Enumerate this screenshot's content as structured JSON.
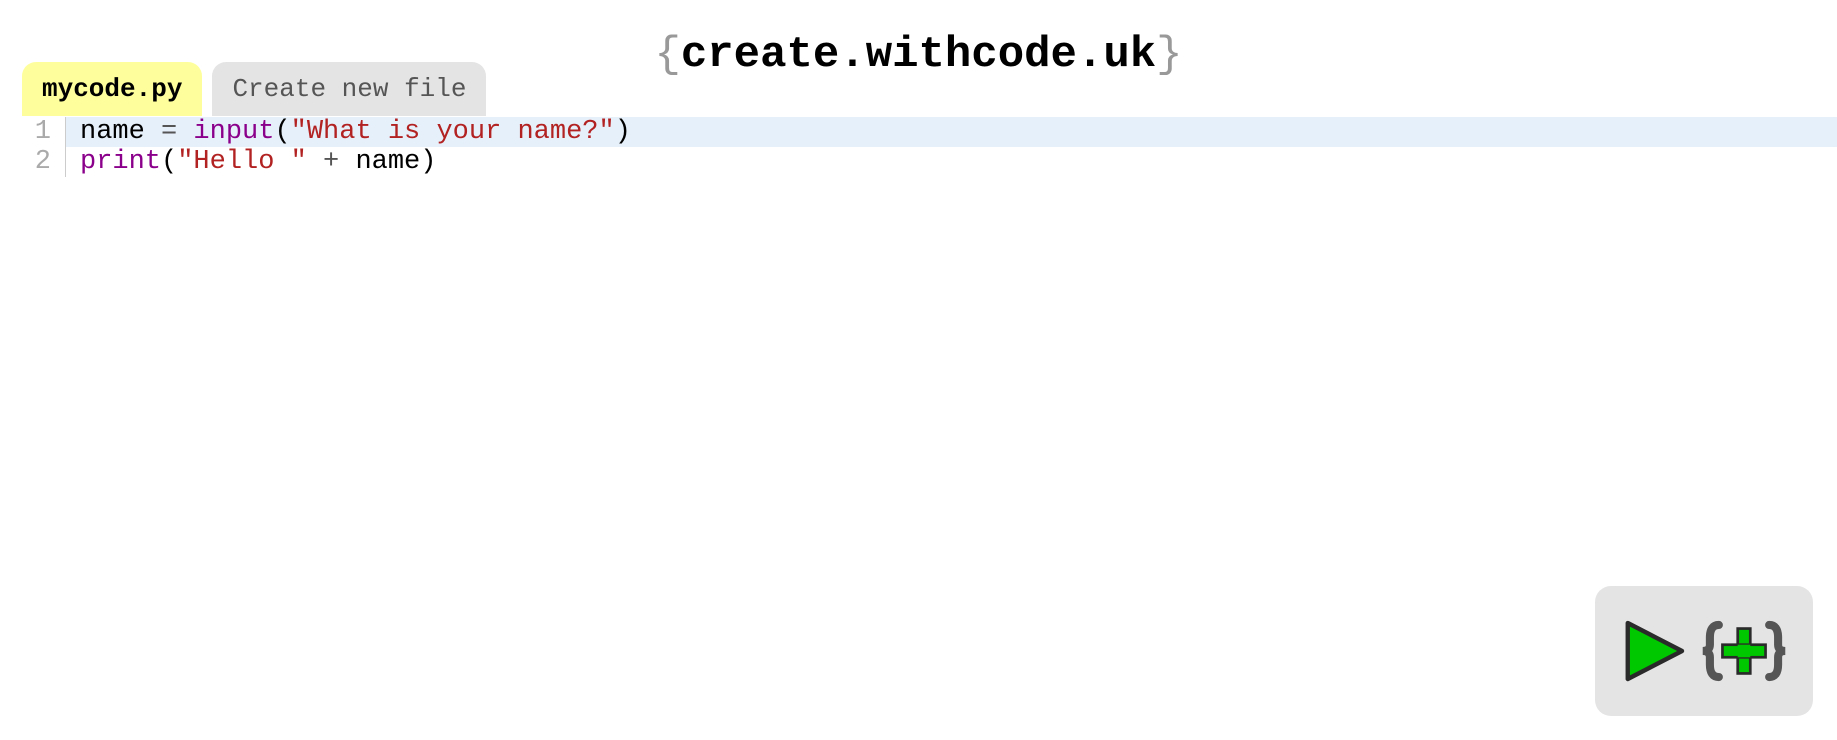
{
  "header": {
    "brace_left": "{",
    "title": "create.withcode.uk",
    "brace_right": "}"
  },
  "tabs": [
    {
      "label": "mycode.py",
      "active": true
    },
    {
      "label": "Create new file",
      "active": false
    }
  ],
  "editor": {
    "lines": [
      {
        "number": "1",
        "highlighted": true,
        "tokens": [
          {
            "text": "name",
            "class": "tok-default"
          },
          {
            "text": " ",
            "class": "tok-default"
          },
          {
            "text": "=",
            "class": "tok-operator"
          },
          {
            "text": " ",
            "class": "tok-default"
          },
          {
            "text": "input",
            "class": "tok-builtin"
          },
          {
            "text": "(",
            "class": "tok-default"
          },
          {
            "text": "\"What is your name?\"",
            "class": "tok-string"
          },
          {
            "text": ")",
            "class": "tok-default"
          }
        ]
      },
      {
        "number": "2",
        "highlighted": false,
        "tokens": [
          {
            "text": "print",
            "class": "tok-builtin"
          },
          {
            "text": "(",
            "class": "tok-default"
          },
          {
            "text": "\"Hello \"",
            "class": "tok-string"
          },
          {
            "text": " ",
            "class": "tok-default"
          },
          {
            "text": "+",
            "class": "tok-operator"
          },
          {
            "text": " ",
            "class": "tok-default"
          },
          {
            "text": "name",
            "class": "tok-default"
          },
          {
            "text": ")",
            "class": "tok-default"
          }
        ]
      }
    ]
  },
  "icons": {
    "play": "play-icon",
    "expand": "expand-icon"
  }
}
